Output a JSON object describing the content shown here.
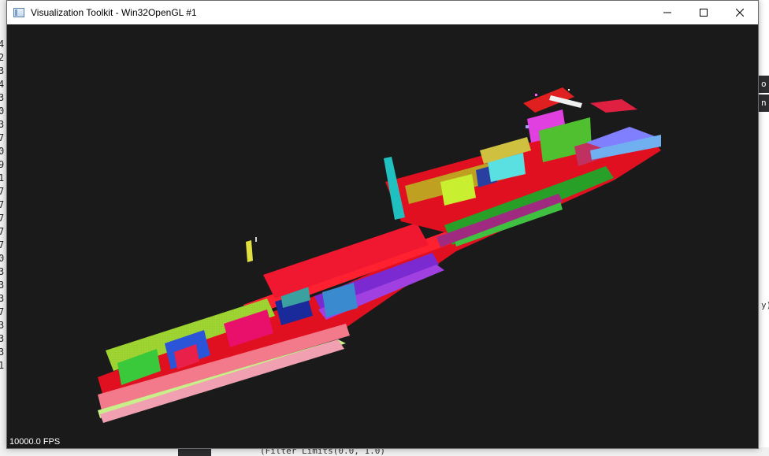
{
  "window": {
    "title": "Visualization Toolkit - Win32OpenGL #1",
    "fps_label": "10000.0 FPS",
    "buttons": {
      "minimize": "minimize",
      "maximize": "maximize",
      "close": "close"
    }
  },
  "background": {
    "left_console_digits": "4\n2\n3\n4\n3\n0\n3\n7\n0\n9\n1\n7\n7\n7\n7\n7\n0\n3\n3\n3\n7\n3\n3\n3\n1",
    "right_fragment_1": "o",
    "right_fragment_2": "n",
    "right_fragment_3": "y)",
    "bottom_code": "(Filter Limits(0.0, 1.0)"
  },
  "colors": {
    "render_background": "#1a1a1a",
    "accent_red": "#ff1a1a"
  },
  "icons": [
    "app-icon",
    "minimize-icon",
    "maximize-icon",
    "close-icon"
  ]
}
